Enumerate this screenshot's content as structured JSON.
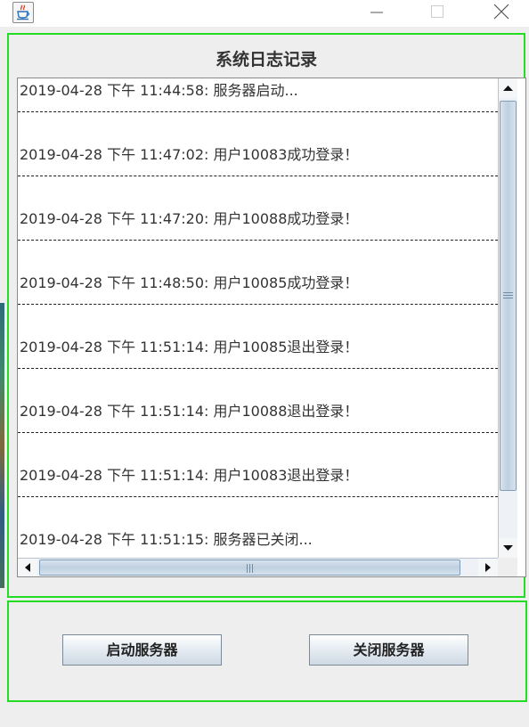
{
  "window": {
    "icon": "java-cup-icon"
  },
  "log_panel": {
    "title": "系统日志记录",
    "entries": [
      "2019-04-28 下午 11:44:58: 服务器启动...",
      "2019-04-28 下午 11:47:02: 用户10083成功登录！",
      "2019-04-28 下午 11:47:20: 用户10088成功登录！",
      "2019-04-28 下午 11:48:50: 用户10085成功登录！",
      "2019-04-28 下午 11:51:14: 用户10085退出登录！",
      "2019-04-28 下午 11:51:14: 用户10088退出登录！",
      "2019-04-28 下午 11:51:14: 用户10083退出登录！",
      "2019-04-28 下午 11:51:15: 服务器已关闭..."
    ],
    "scroll": {
      "vertical_position": 0.0,
      "vertical_visible_fraction": 0.85
    }
  },
  "buttons": {
    "start_label": "启动服务器",
    "stop_label": "关闭服务器"
  },
  "colors": {
    "panel_border": "#22dd22",
    "background": "#eeeeee",
    "scrollbar_thumb": "#bfd0e0"
  }
}
